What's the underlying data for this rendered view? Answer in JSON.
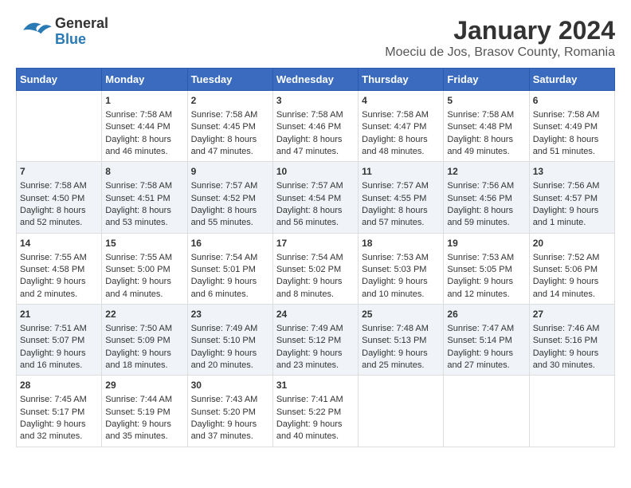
{
  "header": {
    "logo_general": "General",
    "logo_blue": "Blue",
    "title": "January 2024",
    "subtitle": "Moeciu de Jos, Brasov County, Romania"
  },
  "days_of_week": [
    "Sunday",
    "Monday",
    "Tuesday",
    "Wednesday",
    "Thursday",
    "Friday",
    "Saturday"
  ],
  "weeks": [
    [
      {
        "day": "",
        "content": ""
      },
      {
        "day": "1",
        "content": "Sunrise: 7:58 AM\nSunset: 4:44 PM\nDaylight: 8 hours\nand 46 minutes."
      },
      {
        "day": "2",
        "content": "Sunrise: 7:58 AM\nSunset: 4:45 PM\nDaylight: 8 hours\nand 47 minutes."
      },
      {
        "day": "3",
        "content": "Sunrise: 7:58 AM\nSunset: 4:46 PM\nDaylight: 8 hours\nand 47 minutes."
      },
      {
        "day": "4",
        "content": "Sunrise: 7:58 AM\nSunset: 4:47 PM\nDaylight: 8 hours\nand 48 minutes."
      },
      {
        "day": "5",
        "content": "Sunrise: 7:58 AM\nSunset: 4:48 PM\nDaylight: 8 hours\nand 49 minutes."
      },
      {
        "day": "6",
        "content": "Sunrise: 7:58 AM\nSunset: 4:49 PM\nDaylight: 8 hours\nand 51 minutes."
      }
    ],
    [
      {
        "day": "7",
        "content": "Sunrise: 7:58 AM\nSunset: 4:50 PM\nDaylight: 8 hours\nand 52 minutes."
      },
      {
        "day": "8",
        "content": "Sunrise: 7:58 AM\nSunset: 4:51 PM\nDaylight: 8 hours\nand 53 minutes."
      },
      {
        "day": "9",
        "content": "Sunrise: 7:57 AM\nSunset: 4:52 PM\nDaylight: 8 hours\nand 55 minutes."
      },
      {
        "day": "10",
        "content": "Sunrise: 7:57 AM\nSunset: 4:54 PM\nDaylight: 8 hours\nand 56 minutes."
      },
      {
        "day": "11",
        "content": "Sunrise: 7:57 AM\nSunset: 4:55 PM\nDaylight: 8 hours\nand 57 minutes."
      },
      {
        "day": "12",
        "content": "Sunrise: 7:56 AM\nSunset: 4:56 PM\nDaylight: 8 hours\nand 59 minutes."
      },
      {
        "day": "13",
        "content": "Sunrise: 7:56 AM\nSunset: 4:57 PM\nDaylight: 9 hours\nand 1 minute."
      }
    ],
    [
      {
        "day": "14",
        "content": "Sunrise: 7:55 AM\nSunset: 4:58 PM\nDaylight: 9 hours\nand 2 minutes."
      },
      {
        "day": "15",
        "content": "Sunrise: 7:55 AM\nSunset: 5:00 PM\nDaylight: 9 hours\nand 4 minutes."
      },
      {
        "day": "16",
        "content": "Sunrise: 7:54 AM\nSunset: 5:01 PM\nDaylight: 9 hours\nand 6 minutes."
      },
      {
        "day": "17",
        "content": "Sunrise: 7:54 AM\nSunset: 5:02 PM\nDaylight: 9 hours\nand 8 minutes."
      },
      {
        "day": "18",
        "content": "Sunrise: 7:53 AM\nSunset: 5:03 PM\nDaylight: 9 hours\nand 10 minutes."
      },
      {
        "day": "19",
        "content": "Sunrise: 7:53 AM\nSunset: 5:05 PM\nDaylight: 9 hours\nand 12 minutes."
      },
      {
        "day": "20",
        "content": "Sunrise: 7:52 AM\nSunset: 5:06 PM\nDaylight: 9 hours\nand 14 minutes."
      }
    ],
    [
      {
        "day": "21",
        "content": "Sunrise: 7:51 AM\nSunset: 5:07 PM\nDaylight: 9 hours\nand 16 minutes."
      },
      {
        "day": "22",
        "content": "Sunrise: 7:50 AM\nSunset: 5:09 PM\nDaylight: 9 hours\nand 18 minutes."
      },
      {
        "day": "23",
        "content": "Sunrise: 7:49 AM\nSunset: 5:10 PM\nDaylight: 9 hours\nand 20 minutes."
      },
      {
        "day": "24",
        "content": "Sunrise: 7:49 AM\nSunset: 5:12 PM\nDaylight: 9 hours\nand 23 minutes."
      },
      {
        "day": "25",
        "content": "Sunrise: 7:48 AM\nSunset: 5:13 PM\nDaylight: 9 hours\nand 25 minutes."
      },
      {
        "day": "26",
        "content": "Sunrise: 7:47 AM\nSunset: 5:14 PM\nDaylight: 9 hours\nand 27 minutes."
      },
      {
        "day": "27",
        "content": "Sunrise: 7:46 AM\nSunset: 5:16 PM\nDaylight: 9 hours\nand 30 minutes."
      }
    ],
    [
      {
        "day": "28",
        "content": "Sunrise: 7:45 AM\nSunset: 5:17 PM\nDaylight: 9 hours\nand 32 minutes."
      },
      {
        "day": "29",
        "content": "Sunrise: 7:44 AM\nSunset: 5:19 PM\nDaylight: 9 hours\nand 35 minutes."
      },
      {
        "day": "30",
        "content": "Sunrise: 7:43 AM\nSunset: 5:20 PM\nDaylight: 9 hours\nand 37 minutes."
      },
      {
        "day": "31",
        "content": "Sunrise: 7:41 AM\nSunset: 5:22 PM\nDaylight: 9 hours\nand 40 minutes."
      },
      {
        "day": "",
        "content": ""
      },
      {
        "day": "",
        "content": ""
      },
      {
        "day": "",
        "content": ""
      }
    ]
  ]
}
